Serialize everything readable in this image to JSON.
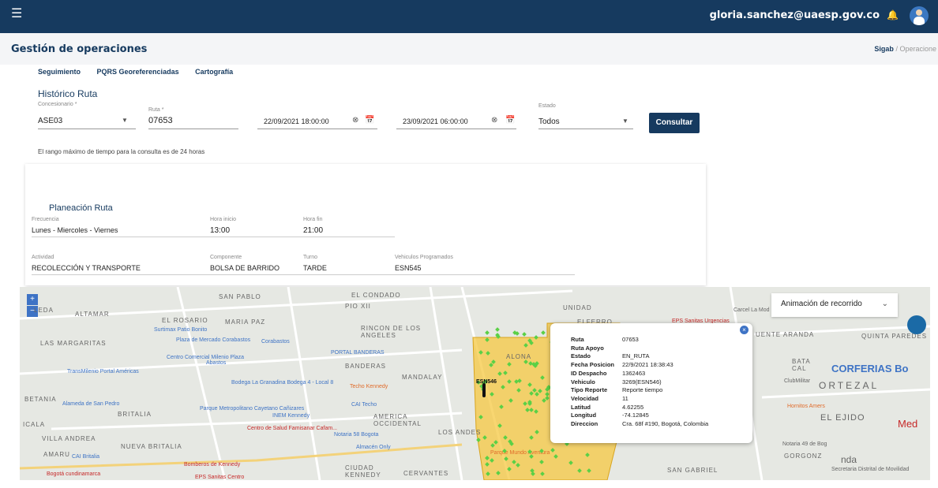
{
  "header": {
    "user_email": "gloria.sanchez@uaesp.gov.co"
  },
  "page": {
    "title": "Gestión de operaciones",
    "breadcrumb_root": "Sigab",
    "breadcrumb_sep": "/",
    "breadcrumb_current": "Operacione"
  },
  "tabs": [
    "Seguimiento",
    "PQRS Georeferenciadas",
    "Cartografía"
  ],
  "historico": {
    "title": "Histórico Ruta",
    "concesionario_label": "Concesionario *",
    "concesionario_value": "ASE03",
    "ruta_label": "Ruta *",
    "ruta_value": "07653",
    "fecha_inicio": "22/09/2021 18:00:00",
    "fecha_fin": "23/09/2021 06:00:00",
    "estado_label": "Estado",
    "estado_value": "Todos",
    "consultar": "Consultar",
    "note": "El rango máximo de tiempo para la consulta es de 24 horas"
  },
  "planeacion": {
    "title": "Planeación Ruta",
    "frecuencia_label": "Frecuencia",
    "frecuencia_value": "Lunes - Miercoles - Viernes",
    "hora_inicio_label": "Hora inicio",
    "hora_inicio_value": "13:00",
    "hora_fin_label": "Hora fin",
    "hora_fin_value": "21:00",
    "actividad_label": "Actividad",
    "actividad_value": "RECOLECCIÓN Y TRANSPORTE",
    "componente_label": "Componente",
    "componente_value": "BOLSA DE BARRIDO",
    "turno_label": "Turno",
    "turno_value": "TARDE",
    "vehiculos_label": "Vehiculos Programados",
    "vehiculos_value": "ESN545"
  },
  "map": {
    "zoom_in": "+",
    "zoom_out": "−",
    "animacion": "Animación de recorrido",
    "vehicle_label": "ESN546",
    "areas": [
      "SAN PABLO",
      "PIO XII",
      "EL CONDADO",
      "UNIDAD",
      "LEDA",
      "ALTAMAR",
      "EL ROSARIO",
      "MARIA PAZ",
      "RINCON DE LOS ANGELES",
      "LAS MARGARITAS",
      "BANDERAS",
      "MANDALAY",
      "BETANIA",
      "BRITALIA",
      "AMERICA OCCIDENTAL",
      "LOS ANDES",
      "VILLA ANDREA",
      "NUEVA BRITALIA",
      "AMARU",
      "CIUDAD KENNEDY",
      "CERVANTES",
      "SAN GABRIEL",
      "ORTEZAL",
      "QUINTA PAREDES",
      "CORFERIAS Bo",
      "GORGONZ",
      "EL EJIDO",
      "ALONA",
      "BATA CAL",
      "ICALA",
      "Med",
      "nda",
      "ELFERRO",
      "UENTE ARANDA"
    ],
    "pois": [
      "Surtimax Patio Bonito",
      "Plaza de Mercado Corabastos",
      "Corabastos",
      "Centro Comercial Milenio Plaza",
      "Abastos",
      "PORTAL BANDERAS",
      "TransMilenio Portal Américas",
      "Bodega La Granadina Bodega 4 - Local 8",
      "Techo Kennedy",
      "CAI Techo",
      "Parque Metropolitano Cayetano Cañizares",
      "INEM Kennedy",
      "Centro de Salud Famisanar Cafam...",
      "Notaria 58 Bogota",
      "Almacén Only",
      "CAI Britalia",
      "Bomberos de Kennedy",
      "EPS Sanitas Centro",
      "Bogotá cundinamarca",
      "Alameda de San Pedro",
      "EPS Sanitas Urgencias",
      "Carcel La Mod",
      "ClubMilitar",
      "Hornitos Amers",
      "Notaria 49 de Bog",
      "Secretaria Distrital de Movilidad",
      "Parque Mundo Aventura"
    ]
  },
  "popup": {
    "rows": [
      {
        "k": "Ruta",
        "v": "07653"
      },
      {
        "k": "Ruta Apoyo",
        "v": ""
      },
      {
        "k": "Estado",
        "v": "EN_RUTA"
      },
      {
        "k": "Fecha Posicion",
        "v": "22/9/2021 18:38:43"
      },
      {
        "k": "ID Despacho",
        "v": "1362463"
      },
      {
        "k": "Vehiculo",
        "v": "3269(ESN546)"
      },
      {
        "k": "Tipo Reporte",
        "v": "Reporte tiempo"
      },
      {
        "k": "Velocidad",
        "v": "11"
      },
      {
        "k": "Latitud",
        "v": "4.62255"
      },
      {
        "k": "Longitud",
        "v": "-74.12845"
      },
      {
        "k": "Direccion",
        "v": "Cra. 68f #190, Bogotá, Colombia"
      }
    ]
  },
  "colors": {
    "primary": "#163a5f",
    "zone": "#f5c842",
    "gps_point": "#5bd046",
    "poi": "#3e73c5"
  }
}
